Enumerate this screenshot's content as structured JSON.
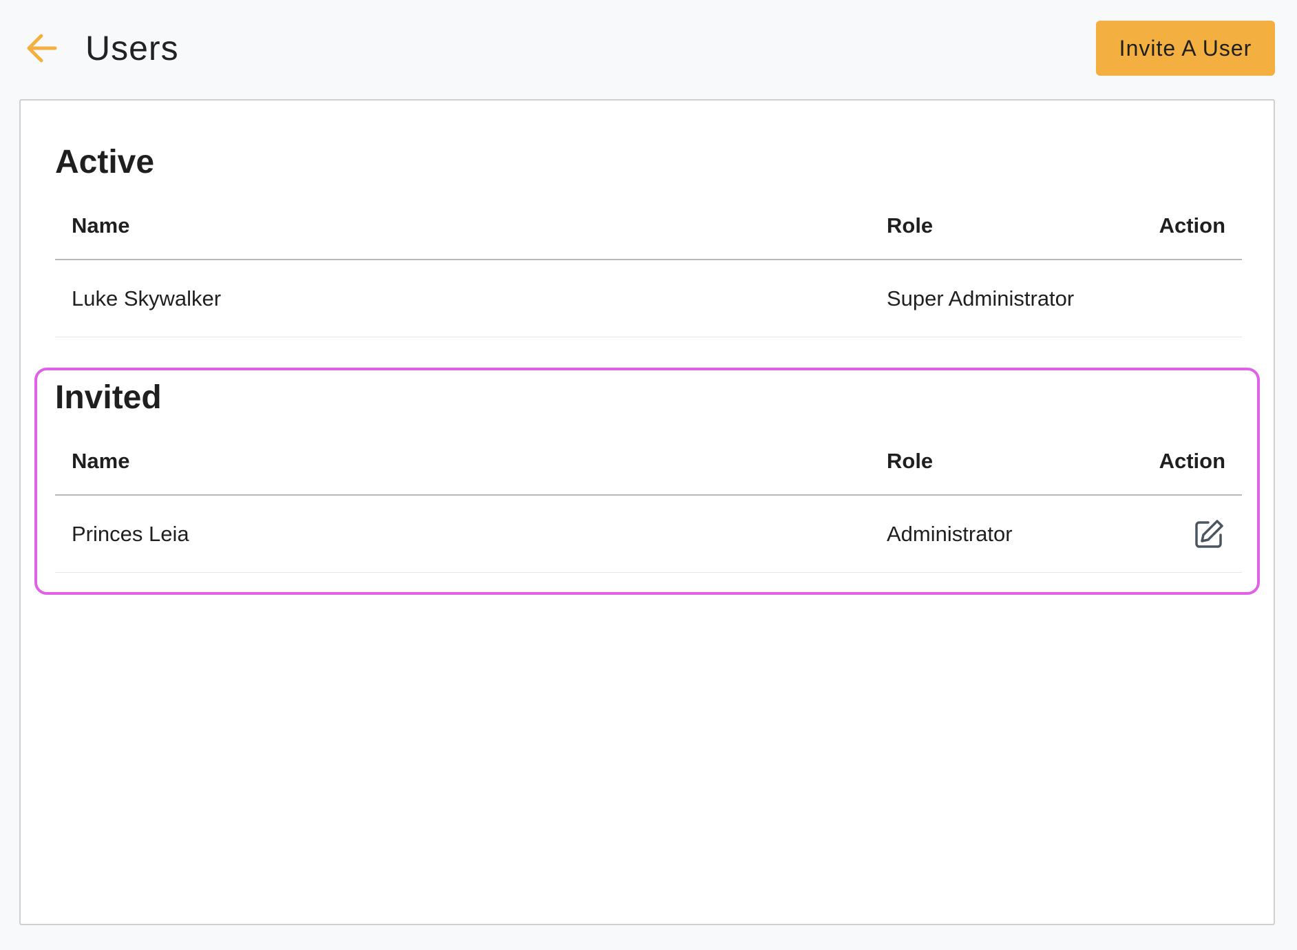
{
  "header": {
    "back_icon": "arrow-left-icon",
    "title": "Users",
    "invite_button_label": "Invite A User",
    "accent_color": "#f3b040"
  },
  "sections": {
    "active": {
      "title": "Active",
      "columns": {
        "name": "Name",
        "role": "Role",
        "action": "Action"
      },
      "rows": [
        {
          "name": "Luke Skywalker",
          "role": "Super Administrator"
        }
      ]
    },
    "invited": {
      "title": "Invited",
      "columns": {
        "name": "Name",
        "role": "Role",
        "action": "Action"
      },
      "rows": [
        {
          "name": "Princes Leia",
          "role": "Administrator",
          "action_icon": "edit-icon"
        }
      ]
    }
  },
  "highlight_color": "#e060e6"
}
